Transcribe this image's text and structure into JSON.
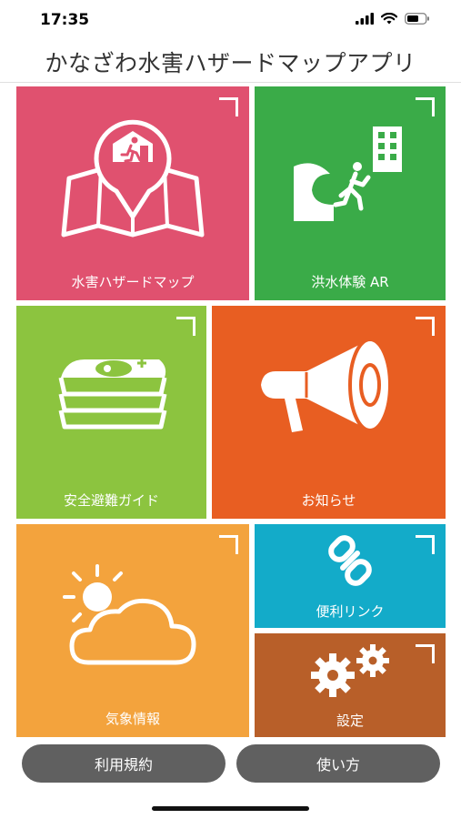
{
  "status": {
    "time": "17:35"
  },
  "app_title": "かなざわ水害ハザードマップアプリ",
  "tiles": [
    {
      "label": "水害ハザードマップ",
      "color": "#e0516f",
      "icon": "evacuation-map-icon"
    },
    {
      "label": "洪水体験 AR",
      "color": "#3aab48",
      "icon": "flood-escape-icon"
    },
    {
      "label": "安全避難ガイド",
      "color": "#8cc43f",
      "icon": "guidebook-stack-icon"
    },
    {
      "label": "お知らせ",
      "color": "#e85e22",
      "icon": "megaphone-icon"
    },
    {
      "label": "気象情報",
      "color": "#f3a33d",
      "icon": "sun-cloud-icon"
    },
    {
      "label": "便利リンク",
      "color": "#13abc9",
      "icon": "link-chain-icon"
    },
    {
      "label": "設定",
      "color": "#b85f29",
      "icon": "gears-icon"
    }
  ],
  "buttons": {
    "terms": "利用規約",
    "how_to_use": "使い方"
  }
}
